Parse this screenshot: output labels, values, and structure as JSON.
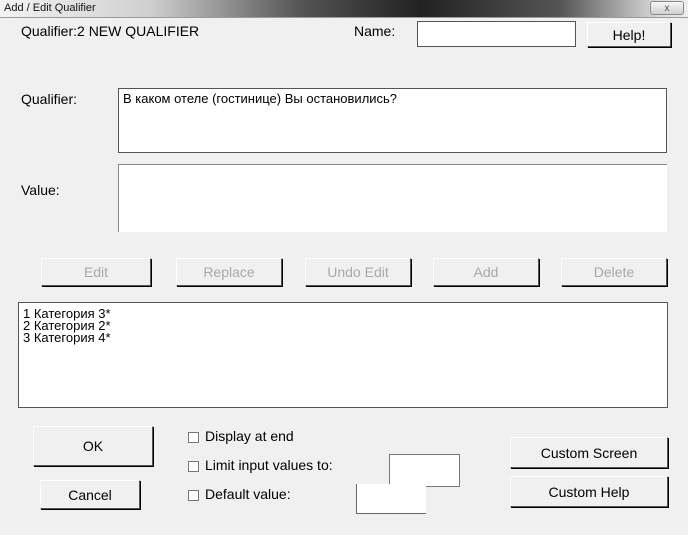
{
  "window": {
    "title": "Add / Edit Qualifier",
    "close_glyph": "x"
  },
  "header": {
    "qualifier_id_label": "Qualifier:2  NEW QUALIFIER",
    "name_label": "Name:",
    "name_value": "",
    "help_button": "Help!"
  },
  "qualifier": {
    "label": "Qualifier:",
    "text": "В каком отеле (гостинице) Вы остановились?"
  },
  "value": {
    "label": "Value:",
    "text": ""
  },
  "actions": {
    "edit": "Edit",
    "replace": "Replace",
    "undo_edit": "Undo Edit",
    "add": "Add",
    "delete": "Delete"
  },
  "values_list": {
    "items": [
      "1  Категория 3*",
      "2  Категория 2*",
      "3  Категория 4*"
    ]
  },
  "footer": {
    "ok_button": "OK",
    "cancel_button": "Cancel",
    "display_at_end_label": "Display at end",
    "display_at_end_checked": false,
    "limit_input_label": "Limit input values to:",
    "limit_input_checked": false,
    "limit_input_value": "",
    "default_value_label": "Default value:",
    "default_value_checked": false,
    "default_value_value": "",
    "custom_screen_button": "Custom Screen",
    "custom_help_button": "Custom Help"
  }
}
